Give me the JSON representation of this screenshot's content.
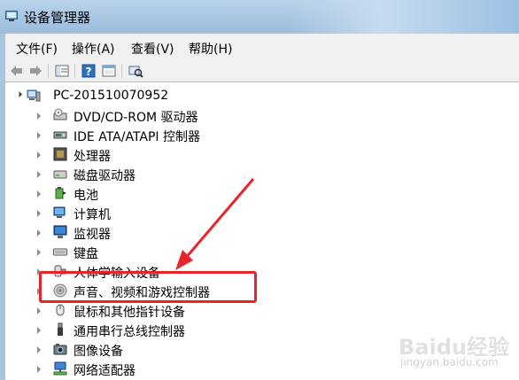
{
  "window": {
    "title": "设备管理器"
  },
  "menu": [
    {
      "label": "文件(F)"
    },
    {
      "label": "操作(A)"
    },
    {
      "label": "查看(V)"
    },
    {
      "label": "帮助(H)"
    }
  ],
  "toolbar": {
    "buttons": [
      "back-arrow-icon",
      "forward-arrow-icon",
      "properties-icon",
      "help-icon",
      "view-icon",
      "scan-hardware-icon"
    ]
  },
  "tree": {
    "root": "PC-201510070952",
    "items": [
      {
        "label": "DVD/CD-ROM 驱动器",
        "icon": "dvd-drive-icon"
      },
      {
        "label": "IDE ATA/ATAPI 控制器",
        "icon": "ide-controller-icon"
      },
      {
        "label": "处理器",
        "icon": "processor-icon"
      },
      {
        "label": "磁盘驱动器",
        "icon": "disk-drive-icon"
      },
      {
        "label": "电池",
        "icon": "battery-icon"
      },
      {
        "label": "计算机",
        "icon": "computer-icon"
      },
      {
        "label": "监视器",
        "icon": "monitor-icon"
      },
      {
        "label": "键盘",
        "icon": "keyboard-icon"
      },
      {
        "label": "人体学输入设备",
        "icon": "hid-icon"
      },
      {
        "label": "声音、视频和游戏控制器",
        "icon": "sound-icon"
      },
      {
        "label": "鼠标和其他指针设备",
        "icon": "mouse-icon"
      },
      {
        "label": "通用串行总线控制器",
        "icon": "usb-icon"
      },
      {
        "label": "图像设备",
        "icon": "camera-icon"
      },
      {
        "label": "网络适配器",
        "icon": "network-icon"
      }
    ]
  },
  "annotation": {
    "color": "#e8242a",
    "highlighted_item": "声音、视频和游戏控制器"
  },
  "watermark": {
    "brand": "Baidu经验",
    "url": "jingyan.baidu.com"
  }
}
